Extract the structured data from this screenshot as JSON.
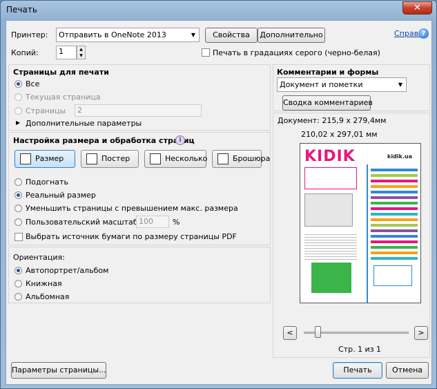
{
  "window": {
    "title": "Печать",
    "close_glyph": "✕"
  },
  "top": {
    "printer_label": "Принтер:",
    "printer_value": "Отправить в OneNote 2013",
    "properties_button": "Свойства",
    "advanced_button": "Дополнительно",
    "help_link": "Справка",
    "copies_label": "Копий:",
    "copies_value": "1",
    "grayscale_label": "Печать в градациях серого (черно-белая)"
  },
  "pages": {
    "title": "Страницы для печати",
    "all": "Все",
    "current": "Текущая страница",
    "pages": "Страницы",
    "pages_value": "2",
    "more": "Дополнительные параметры"
  },
  "sizing": {
    "title": "Настройка размера и обработка страниц",
    "tabs": [
      "Размер",
      "Постер",
      "Несколько",
      "Брошюра"
    ],
    "fit": "Подогнать",
    "actual": "Реальный размер",
    "shrink": "Уменьшить страницы с превышением макс. размера",
    "custom": "Пользовательский масштаб:",
    "custom_value": "100",
    "percent": "%",
    "paper_source": "Выбрать источник бумаги по размеру страницы PDF"
  },
  "orientation": {
    "title": "Ориентация:",
    "auto": "Автопортрет/альбом",
    "portrait": "Книжная",
    "landscape": "Альбомная"
  },
  "comments": {
    "title": "Комментарии и формы",
    "value": "Документ и пометки",
    "summary_button": "Сводка комментариев"
  },
  "preview": {
    "doc_size": "Документ: 215,9 x 279,4мм",
    "paper_size": "210,02 x 297,01 мм",
    "page_counter": "Стр. 1 из 1",
    "prev": "<",
    "next": ">",
    "logo_left": "KIDIK",
    "logo_right": "kidik.ua"
  },
  "footer": {
    "page_setup": "Параметры страницы...",
    "print": "Печать",
    "cancel": "Отмена"
  }
}
